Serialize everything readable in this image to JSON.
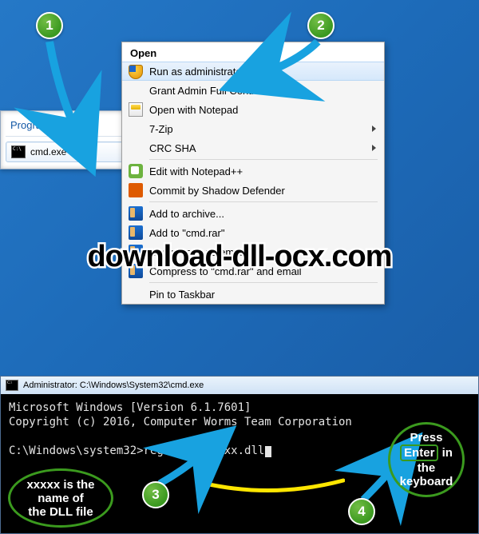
{
  "badges": {
    "b1": "1",
    "b2": "2",
    "b3": "3",
    "b4": "4"
  },
  "start": {
    "programs_label": "Programs (1)",
    "cmd_item": "cmd.exe"
  },
  "context_menu": {
    "header": "Open",
    "items": [
      {
        "label": "Run as administrator",
        "icon": "shield",
        "highlight": true
      },
      {
        "label": "Grant Admin Full Control"
      },
      {
        "label": "Open with Notepad",
        "icon": "notepad"
      },
      {
        "label": "7-Zip",
        "sub": true
      },
      {
        "label": "CRC SHA",
        "sub": true
      },
      {
        "sep": true
      },
      {
        "label": "Edit with Notepad++",
        "icon": "npp"
      },
      {
        "label": "Commit by Shadow Defender",
        "icon": "sd"
      },
      {
        "sep": true
      },
      {
        "label": "Add to archive...",
        "icon": "rarbook"
      },
      {
        "label": "Add to \"cmd.rar\"",
        "icon": "rarbook"
      },
      {
        "label": "Compress and email...",
        "icon": "rarbook"
      },
      {
        "label": "Compress to \"cmd.rar\" and email",
        "icon": "rarbook"
      },
      {
        "sep": true
      },
      {
        "label": "Pin to Taskbar"
      }
    ]
  },
  "watermark": "download-dll-ocx.com",
  "cmd_window": {
    "title": "Administrator: C:\\Windows\\System32\\cmd.exe",
    "line1": "Microsoft Windows [Version 6.1.7601]",
    "line2": "Copyright (c) 2016, Computer Worms Team Corporation",
    "prompt": "C:\\Windows\\system32>",
    "command": "regsvr32 xxxxx.dll"
  },
  "annotations": {
    "left_line1": "xxxxx is the",
    "left_line2": "name of",
    "left_line3": "the DLL file",
    "right_line1": "Press",
    "right_enter": "Enter",
    "right_line2": "in",
    "right_line3": "the",
    "right_line4": "keyboard"
  }
}
